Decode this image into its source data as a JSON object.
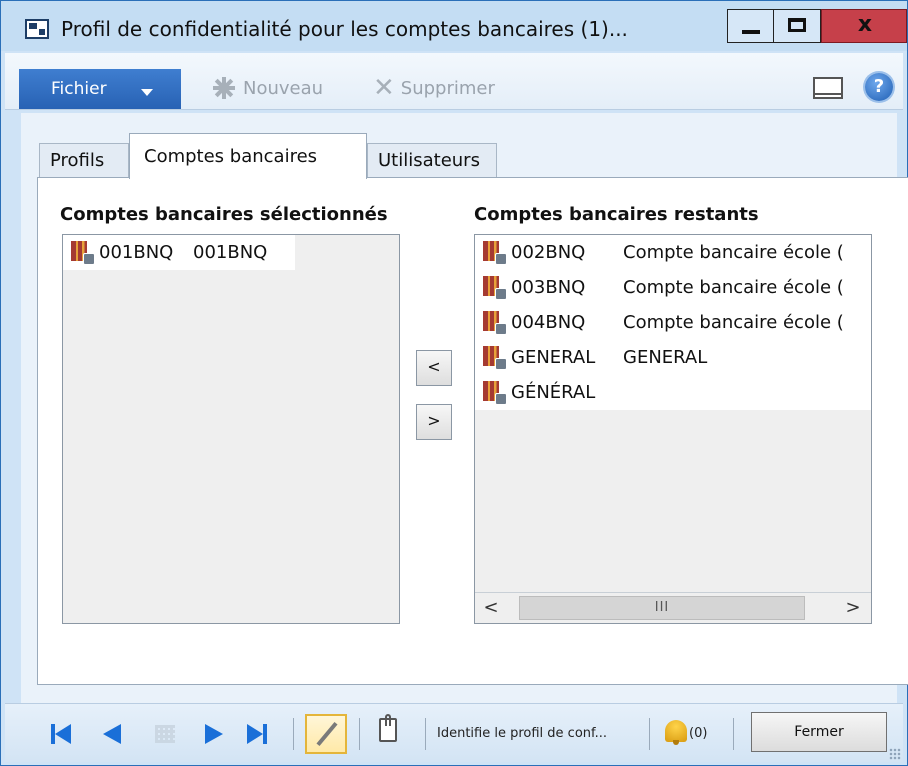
{
  "window": {
    "title": "Profil de confidentialité pour les comptes bancaires (1)...",
    "close_glyph": "x"
  },
  "toolbar": {
    "file_label": "Fichier",
    "new_label": "Nouveau",
    "delete_label": "Supprimer"
  },
  "tabs": [
    {
      "label": "Profils"
    },
    {
      "label": "Comptes bancaires"
    },
    {
      "label": "Utilisateurs"
    }
  ],
  "selected": {
    "title": "Comptes bancaires sélectionnés",
    "items": [
      {
        "code": "001BNQ",
        "desc": "001BNQ"
      }
    ]
  },
  "remaining": {
    "title": "Comptes bancaires restants",
    "items": [
      {
        "code": "002BNQ",
        "desc": "Compte bancaire école ("
      },
      {
        "code": "003BNQ",
        "desc": "Compte bancaire école ("
      },
      {
        "code": "004BNQ",
        "desc": "Compte bancaire école ("
      },
      {
        "code": "GENERAL",
        "desc": "GENERAL"
      },
      {
        "code": "GÉNÉRAL",
        "desc": ""
      }
    ]
  },
  "move_buttons": {
    "add_label": "<",
    "remove_label": ">"
  },
  "scrollbar": {
    "left_arrow": "<",
    "right_arrow": ">",
    "thumb_grip": "III"
  },
  "statusbar": {
    "description": "Identifie le profil de conf...",
    "alert_count": "(0)",
    "close_label": "Fermer"
  },
  "colors": {
    "accent": "#2862b4",
    "window_frame": "#cfe3f6",
    "close_red": "#c6404a"
  }
}
